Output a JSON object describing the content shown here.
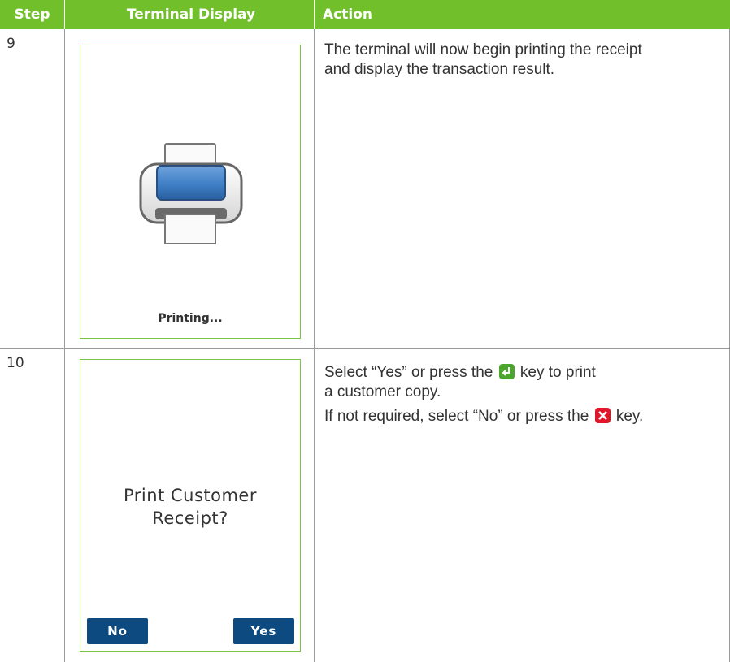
{
  "header": {
    "step": "Step",
    "terminal": "Terminal Display",
    "action": "Action"
  },
  "rows": [
    {
      "step": "9",
      "screen_label": "Printing...",
      "action": [
        "The terminal will now begin printing the receipt",
        "and display the transaction result."
      ]
    },
    {
      "step": "10",
      "prompt_line1": "Print Customer",
      "prompt_line2": "Receipt?",
      "no_label": "No",
      "yes_label": "Yes",
      "action_a_pre": "Select “Yes” or press the",
      "action_a_post": "key to print",
      "action_a_line2": "a customer copy.",
      "action_b_pre": "If not required, select “No” or press the",
      "action_b_post": "key."
    }
  ],
  "icons": {
    "printer": "printer-icon",
    "enter_key": "enter-key-icon",
    "cancel_key": "cancel-key-icon"
  },
  "colors": {
    "header_green": "#70bf2b",
    "screen_border": "#7cc243",
    "button_blue": "#0d4a80",
    "enter_green": "#4ca52c",
    "cancel_red": "#e0162b"
  }
}
